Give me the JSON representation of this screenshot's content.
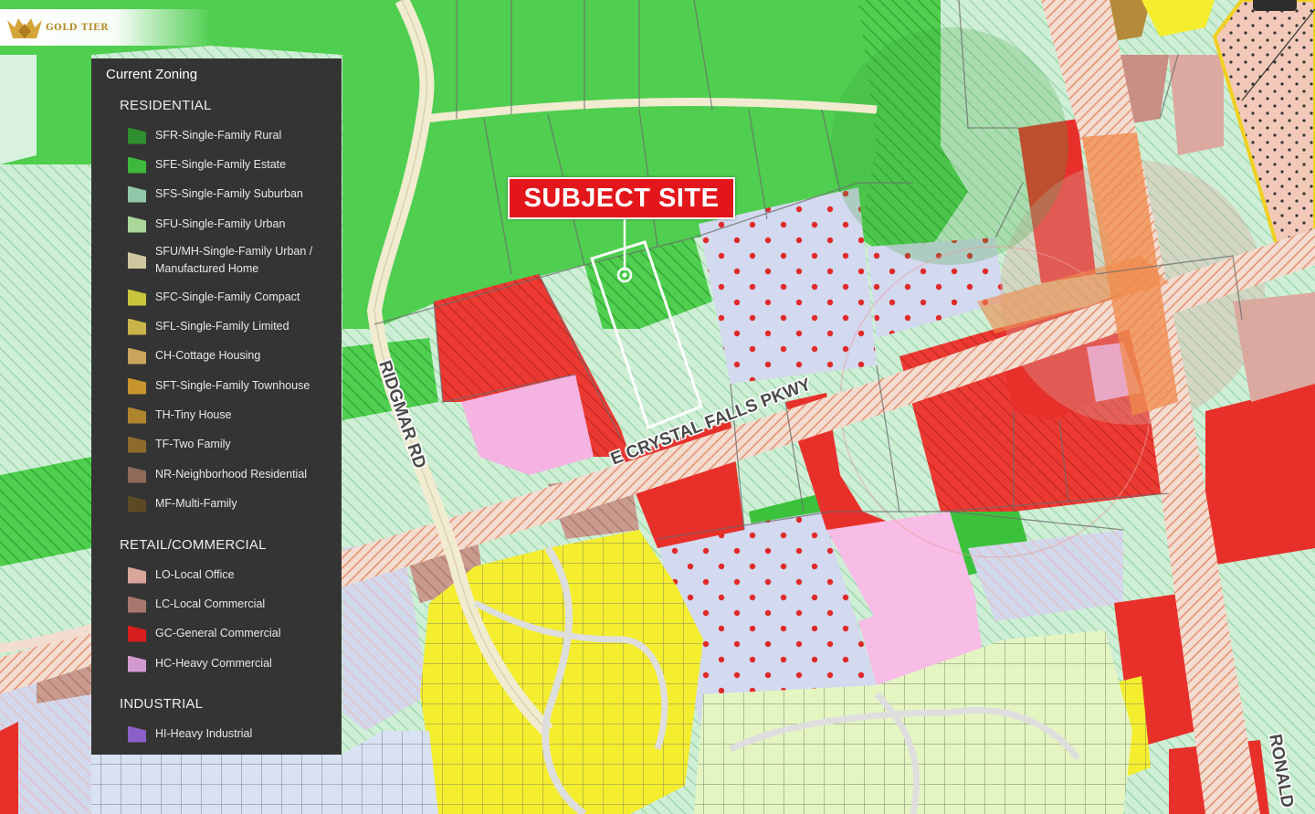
{
  "brand": {
    "logo_text": "GOLD TIER"
  },
  "legend": {
    "title": "Current Zoning",
    "sections": [
      {
        "title": "RESIDENTIAL",
        "items": [
          {
            "label": "SFR-Single-Family Rural",
            "color": "#2f8f2f"
          },
          {
            "label": "SFE-Single-Family Estate",
            "color": "#3cb83c"
          },
          {
            "label": "SFS-Single-Family Suburban",
            "color": "#8fc7a8"
          },
          {
            "label": "SFU-Single-Family Urban",
            "color": "#a9d89a"
          },
          {
            "label": "SFU/MH-Single-Family Urban / Manufactured Home",
            "color": "#cfc6a0"
          },
          {
            "label": "SFC-Single-Family Compact",
            "color": "#c8c43c"
          },
          {
            "label": "SFL-Single-Family Limited",
            "color": "#c9b44a"
          },
          {
            "label": "CH-Cottage Housing",
            "color": "#c9a45a"
          },
          {
            "label": "SFT-Single-Family Townhouse",
            "color": "#c8942e"
          },
          {
            "label": "TH-Tiny House",
            "color": "#b0852f"
          },
          {
            "label": "TF-Two Family",
            "color": "#8e6b2c"
          },
          {
            "label": "NR-Neighborhood Residential",
            "color": "#8e6a5a"
          },
          {
            "label": "MF-Multi-Family",
            "color": "#5c4a24"
          }
        ]
      },
      {
        "title": "RETAIL/COMMERCIAL",
        "items": [
          {
            "label": "LO-Local Office",
            "color": "#d8a59a"
          },
          {
            "label": "LC-Local Commercial",
            "color": "#a8786e"
          },
          {
            "label": "GC-General Commercial",
            "color": "#d61e1e"
          },
          {
            "label": "HC-Heavy Commercial",
            "color": "#d39ad0"
          }
        ]
      },
      {
        "title": "INDUSTRIAL",
        "items": [
          {
            "label": "HI-Heavy Industrial",
            "color": "#8a60c8"
          }
        ]
      }
    ]
  },
  "map": {
    "subject_label": "SUBJECT SITE",
    "roads": {
      "ridgmar": "RIDGMAR RD",
      "crystal_falls": "E CRYSTAL FALLS PKWY",
      "ronald": "RONALD"
    },
    "colors": {
      "estate_green": "#4fce4f",
      "urban_light": "#c9ecd0",
      "commercial_red": "#e8302b",
      "heavy_commercial_pink": "#f4b3e1",
      "subdivision_yellow": "#f4ee2e",
      "dotted_blue": "#ccd4ea",
      "local_office": "#dba9a0"
    }
  }
}
